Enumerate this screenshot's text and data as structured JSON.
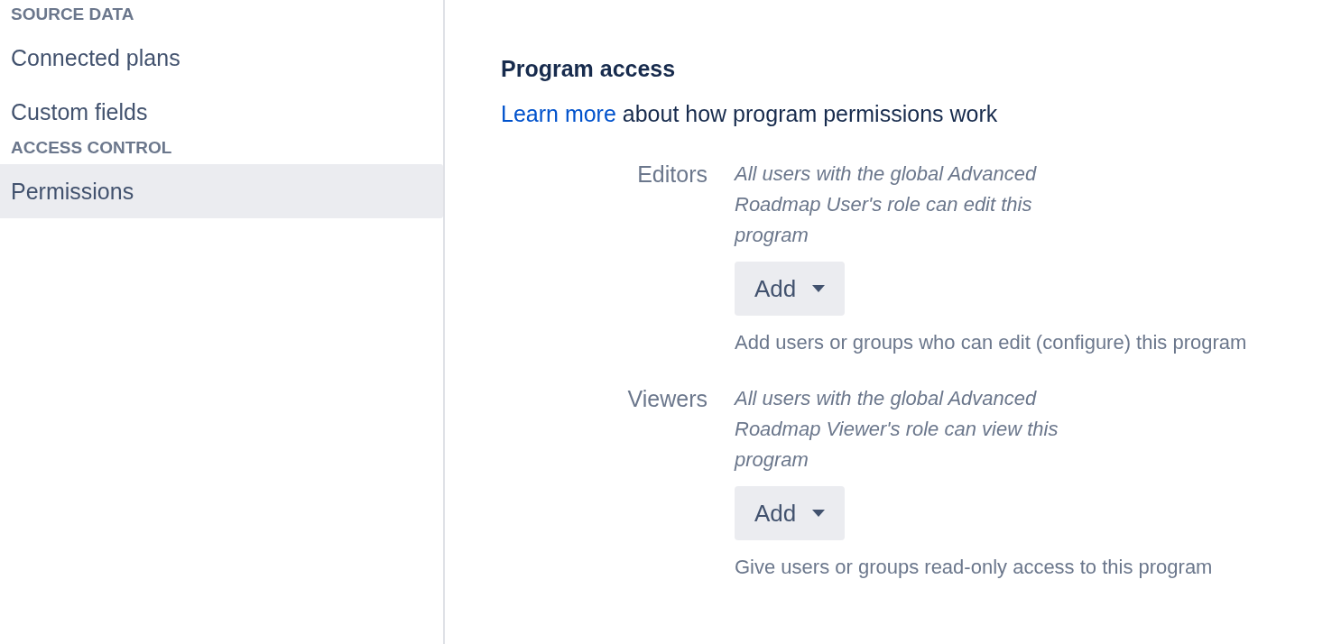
{
  "sidebar": {
    "sections": [
      {
        "heading": "SOURCE DATA",
        "items": [
          {
            "label": "Connected plans",
            "selected": false
          },
          {
            "label": "Custom fields",
            "selected": false
          }
        ]
      },
      {
        "heading": "ACCESS CONTROL",
        "items": [
          {
            "label": "Permissions",
            "selected": true
          }
        ]
      }
    ]
  },
  "main": {
    "title": "Program access",
    "intro": {
      "link": "Learn more",
      "text": "about how program permissions work"
    },
    "fields": [
      {
        "label": "Editors",
        "description": "All users with the global Advanced Roadmap User's role can edit this program",
        "button": "Add",
        "help": "Add users or groups who can edit (configure) this program"
      },
      {
        "label": "Viewers",
        "description": "All users with the global Advanced Roadmap Viewer's role can view this program",
        "button": "Add",
        "help": "Give users or groups read-only access to this program"
      }
    ]
  }
}
